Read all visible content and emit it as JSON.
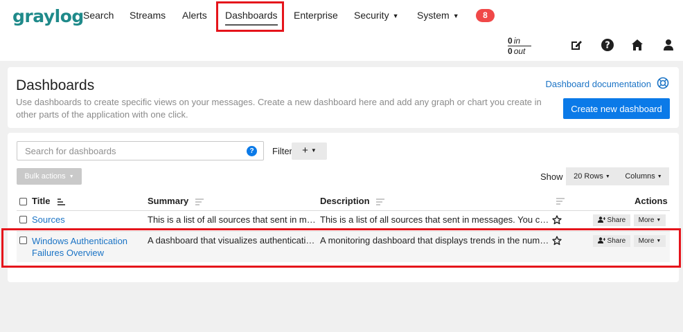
{
  "nav": {
    "logo": "graylog",
    "items": [
      {
        "label": "Search"
      },
      {
        "label": "Streams"
      },
      {
        "label": "Alerts"
      },
      {
        "label": "Dashboards"
      },
      {
        "label": "Enterprise"
      },
      {
        "label": "Security"
      },
      {
        "label": "System"
      }
    ],
    "badge": "8",
    "throughput": {
      "in_value": "0",
      "in_unit": "in",
      "out_value": "0",
      "out_unit": "out"
    }
  },
  "header": {
    "title": "Dashboards",
    "description": "Use dashboards to create specific views on your messages. Create a new dashboard here and add any graph or chart you create in other parts of the application with one click.",
    "doc_link": "Dashboard documentation",
    "create_button": "Create new dashboard"
  },
  "toolbar": {
    "search_placeholder": "Search for dashboards",
    "search_help": "?",
    "filters_label": "Filters",
    "filter_add": "+",
    "bulk_actions": "Bulk actions",
    "show_label": "Show",
    "rows_label": "20 Rows",
    "columns_label": "Columns"
  },
  "table": {
    "headers": {
      "title": "Title",
      "summary": "Summary",
      "description": "Description",
      "actions": "Actions"
    },
    "rows": [
      {
        "title": "Sources",
        "summary": "This is a list of all sources that sent in messages to Graylog.",
        "description": "This is a list of all sources that sent in messages. You can narrow the timerange by zooming in on the message histogram.",
        "share": "Share",
        "more": "More"
      },
      {
        "title_line1": "Windows Authentication",
        "title_line2": "Failures Overview",
        "summary": "A dashboard that visualizes authentication failures.",
        "description": "A monitoring dashboard that displays trends in the number of authentication failures.",
        "share": "Share",
        "more": "More"
      }
    ]
  },
  "colors": {
    "accent": "#0b7ae8",
    "link": "#1a73c5",
    "highlight": "#e5141b",
    "badge": "#f04848"
  }
}
